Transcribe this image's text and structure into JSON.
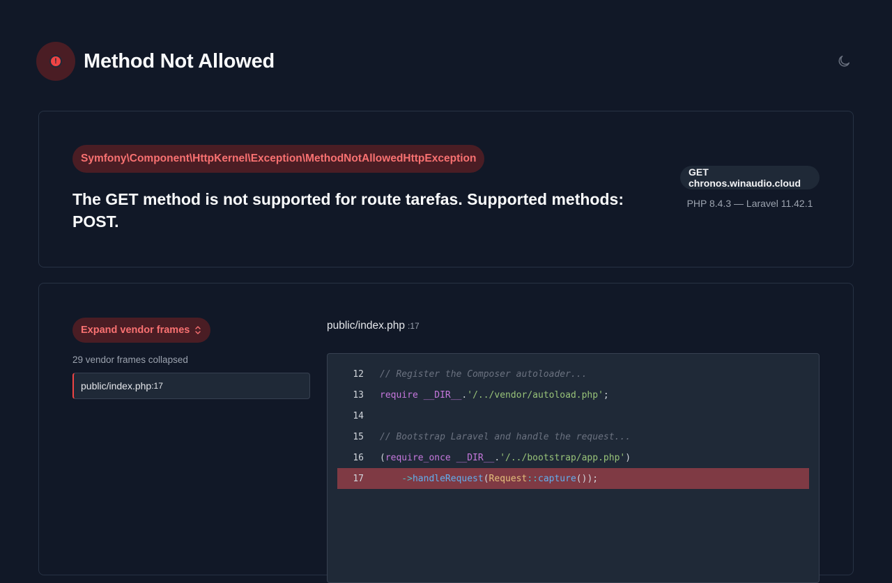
{
  "header": {
    "title": "Method Not Allowed",
    "error_icon": "alert-circle-icon",
    "theme_icon": "moon-icon"
  },
  "exception": {
    "class": "Symfony\\Component\\HttpKernel\\Exception\\MethodNotAllowedHttpException",
    "message": "The GET method is not supported for route tarefas. Supported methods: POST.",
    "request": "GET chronos.winaudio.cloud",
    "versions": "PHP 8.4.3 — Laravel 11.42.1"
  },
  "trace": {
    "expand_label": "Expand vendor frames",
    "collapsed_note": "29 vendor frames collapsed",
    "frames": [
      {
        "file": "public/index.php",
        "line": ":17"
      }
    ],
    "file_header": {
      "file": "public/index.php",
      "line": ":17"
    }
  },
  "code": {
    "line_numbers": [
      "12",
      "13",
      "14",
      "15",
      "16",
      "17"
    ],
    "highlight_line": "17",
    "lines": {
      "l12_comment": "// Register the Composer autoloader...",
      "l13_kw": "require",
      "l13_const": " __DIR__",
      "l13_dot": ".",
      "l13_str": "'/../vendor/autoload.php'",
      "l13_end": ";",
      "l15_comment": "// Bootstrap Laravel and handle the request...",
      "l16_open": "(",
      "l16_kw": "require_once",
      "l16_const": " __DIR__",
      "l16_dot": ".",
      "l16_str": "'/../bootstrap/app.php'",
      "l16_close": ")",
      "l17_arrow": "    ->",
      "l17_fn": "handleRequest",
      "l17_paren": "(",
      "l17_cls": "Request",
      "l17_sep": "::",
      "l17_fn2": "capture",
      "l17_end": "());"
    }
  },
  "colors": {
    "background": "#111827",
    "accent_red": "#ef4444",
    "badge_bg": "#4a1d24",
    "highlight_line": "#7f3a44"
  }
}
